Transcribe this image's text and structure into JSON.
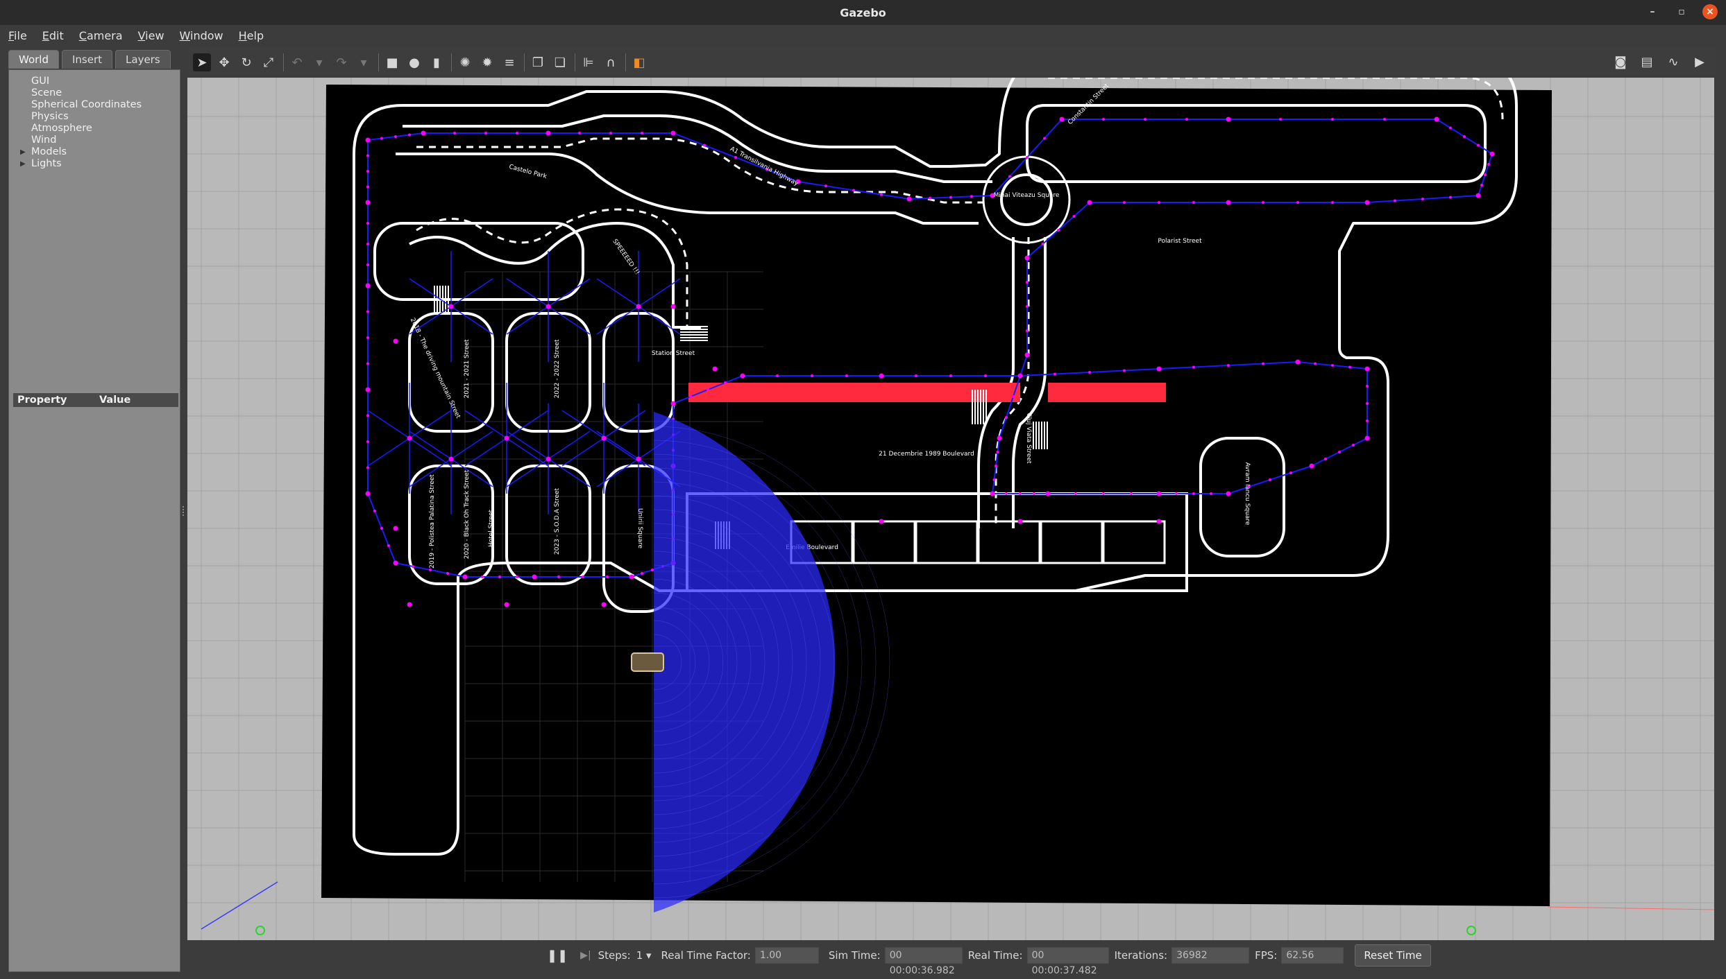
{
  "window": {
    "title": "Gazebo",
    "controls": [
      "–",
      "▫",
      "×"
    ]
  },
  "menu": [
    "File",
    "Edit",
    "Camera",
    "View",
    "Window",
    "Help"
  ],
  "left_panel": {
    "tabs": [
      "World",
      "Insert",
      "Layers"
    ],
    "active_tab": "World",
    "tree": [
      {
        "label": "GUI",
        "expandable": false
      },
      {
        "label": "Scene",
        "expandable": false
      },
      {
        "label": "Spherical Coordinates",
        "expandable": false
      },
      {
        "label": "Physics",
        "expandable": false
      },
      {
        "label": "Atmosphere",
        "expandable": false
      },
      {
        "label": "Wind",
        "expandable": false
      },
      {
        "label": "Models",
        "expandable": true
      },
      {
        "label": "Lights",
        "expandable": true
      }
    ],
    "property_header": {
      "property": "Property",
      "value": "Value"
    }
  },
  "toolbar": {
    "tools": [
      {
        "name": "select-icon",
        "glyph": "➤",
        "selected": true
      },
      {
        "name": "translate-icon",
        "glyph": "✥"
      },
      {
        "name": "rotate-icon",
        "glyph": "↻"
      },
      {
        "name": "scale-icon",
        "glyph": "⤢"
      },
      {
        "name": "undo-icon",
        "glyph": "↶",
        "dim": true
      },
      {
        "name": "undo-dropdown-icon",
        "glyph": "▾",
        "dim": true
      },
      {
        "name": "redo-icon",
        "glyph": "↷",
        "dim": true
      },
      {
        "name": "redo-dropdown-icon",
        "glyph": "▾",
        "dim": true
      },
      {
        "name": "box-shape-icon",
        "glyph": "■"
      },
      {
        "name": "sphere-shape-icon",
        "glyph": "●"
      },
      {
        "name": "cylinder-shape-icon",
        "glyph": "▮"
      },
      {
        "name": "point-light-icon",
        "glyph": "✺"
      },
      {
        "name": "spot-light-icon",
        "glyph": "✹"
      },
      {
        "name": "directional-light-icon",
        "glyph": "≡"
      },
      {
        "name": "copy-icon",
        "glyph": "❐"
      },
      {
        "name": "paste-icon",
        "glyph": "❏"
      },
      {
        "name": "align-icon",
        "glyph": "⊫"
      },
      {
        "name": "snap-icon",
        "glyph": "∩"
      },
      {
        "name": "change-view-icon",
        "glyph": "◧"
      }
    ],
    "right_tools": [
      {
        "name": "screenshot-icon",
        "glyph": "◙"
      },
      {
        "name": "log-icon",
        "glyph": "▤"
      },
      {
        "name": "plot-icon",
        "glyph": "∿"
      },
      {
        "name": "video-icon",
        "glyph": "▶"
      }
    ]
  },
  "scene": {
    "ground_color": "#b9b9b9",
    "map_color": "#000000",
    "road_color": "#ffffff",
    "graph_color": "#1a1aff",
    "node_color": "#ff00ff",
    "highlight_color": "#ff2a3d",
    "sensor_color": "#2b2bff",
    "map_labels": [
      {
        "key": "a1",
        "text": "A1 Transilvania Highway"
      },
      {
        "key": "castle",
        "text": "Castelo Park"
      },
      {
        "key": "const",
        "text": "Constantin Street"
      },
      {
        "key": "mihai",
        "text": "Mihai Viteazu Square"
      },
      {
        "key": "polaris",
        "text": "Polarist Street"
      },
      {
        "key": "speed",
        "text": "SPEEEEED !!!"
      },
      {
        "key": "cluj",
        "text": "Cluj Viata Street"
      },
      {
        "key": "bd",
        "text": "21 Decembrie 1989 Boulevard"
      },
      {
        "key": "avram",
        "text": "Avram Iancu Square"
      },
      {
        "key": "emilie",
        "text": "Emilie Boulevard"
      },
      {
        "key": "unirii",
        "text": "Unirii Square"
      },
      {
        "key": "soda",
        "text": "2023 - S.O.D.A Street"
      },
      {
        "key": "black",
        "text": "2020 - Black Oh Track Street"
      },
      {
        "key": "polistea",
        "text": "2019 - Polistea Palatina Street"
      },
      {
        "key": "hotel",
        "text": "Hotel Street"
      },
      {
        "key": "year2022",
        "text": "2022 - 2022 Street"
      },
      {
        "key": "year2021",
        "text": "2021 - 2021 Street"
      },
      {
        "key": "climb",
        "text": "2018 - The driving mountain Street"
      },
      {
        "key": "station",
        "text": "Station Street"
      }
    ]
  },
  "bottom_bar": {
    "steps_label": "Steps:",
    "steps_value": "1",
    "rtf_label": "Real Time Factor:",
    "rtf_value": "1.00",
    "sim_time_label": "Sim Time:",
    "sim_time_value": "00 00:00:36.982",
    "real_time_label": "Real Time:",
    "real_time_value": "00 00:00:37.482",
    "iterations_label": "Iterations:",
    "iterations_value": "36982",
    "fps_label": "FPS:",
    "fps_value": "62.56",
    "reset_label": "Reset Time"
  }
}
